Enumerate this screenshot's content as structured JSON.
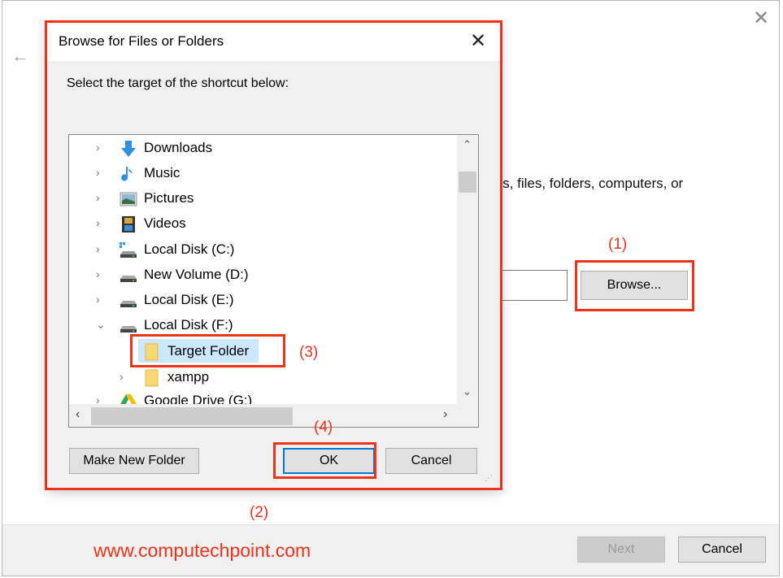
{
  "wizard": {
    "back_icon": "arrow-left-icon",
    "close_icon": "close-icon",
    "description_fragment": "ms, files, folders, computers, or",
    "browse_label": "Browse...",
    "next_label": "Next",
    "cancel_label": "Cancel"
  },
  "dialog": {
    "title": "Browse for Files or Folders",
    "prompt": "Select the target of the shortcut below:",
    "tree": [
      {
        "label": "Downloads",
        "icon": "downloads-icon",
        "expanded": false
      },
      {
        "label": "Music",
        "icon": "music-icon",
        "expanded": false
      },
      {
        "label": "Pictures",
        "icon": "pictures-icon",
        "expanded": false
      },
      {
        "label": "Videos",
        "icon": "videos-icon",
        "expanded": false
      },
      {
        "label": "Local Disk (C:)",
        "icon": "system-drive-icon",
        "expanded": false
      },
      {
        "label": "New Volume (D:)",
        "icon": "drive-icon",
        "expanded": false
      },
      {
        "label": "Local Disk (E:)",
        "icon": "drive-icon",
        "expanded": false
      },
      {
        "label": "Local Disk (F:)",
        "icon": "drive-icon",
        "expanded": true
      },
      {
        "label": "Target Folder",
        "icon": "folder-icon",
        "selected": true
      },
      {
        "label": "xampp",
        "icon": "folder-icon",
        "expanded": false
      },
      {
        "label": "Google Drive (G:)",
        "icon": "google-drive-icon",
        "expanded": false
      }
    ],
    "make_new_folder_label": "Make New Folder",
    "ok_label": "OK",
    "cancel_label": "Cancel"
  },
  "annotations": {
    "step1": "(1)",
    "step2": "(2)",
    "step3": "(3)",
    "step4": "(4)",
    "accent": "#f0321c"
  },
  "watermark": "www.computechpoint.com"
}
